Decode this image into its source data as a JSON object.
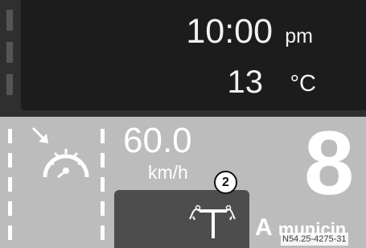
{
  "top_display": {
    "time": "10:00",
    "time_unit": "pm",
    "temperature": "13",
    "temperature_unit": "°C"
  },
  "bottom_display": {
    "speed_value": "60.0",
    "speed_unit": "km/h",
    "gear": "8",
    "ammo_label_initial": "A",
    "ammo_label_rest": "municin",
    "callout_number": "2",
    "icons": [
      "cruise-control-speedometer-icon",
      "arrow-indicator-icon",
      "field-tool-t-icon"
    ]
  },
  "figure_code": "N54.25-4275-31",
  "colors": {
    "top_background": "#1c1c1c",
    "bottom_background": "#bcbcbc",
    "dark_box": "#4d4d4d",
    "text_light": "#ffffff"
  }
}
